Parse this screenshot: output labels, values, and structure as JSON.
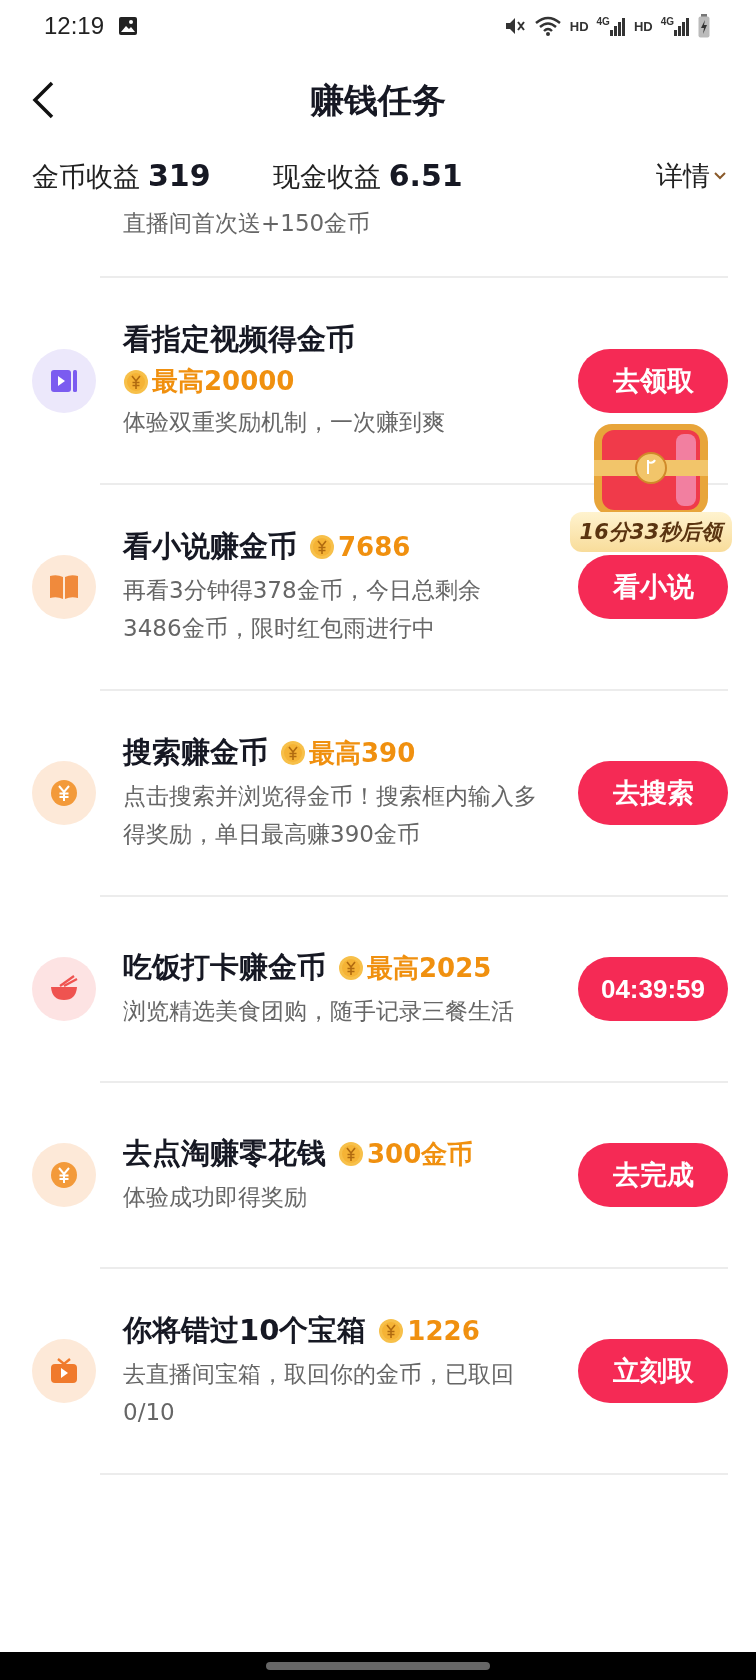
{
  "status_bar": {
    "time": "12:19",
    "indicators": [
      "HD",
      "4G",
      "HD",
      "4G"
    ]
  },
  "header": {
    "title": "赚钱任务"
  },
  "earnings": [
    {
      "label": "金币收益",
      "value": "319"
    },
    {
      "label": "现金收益",
      "value": "6.51"
    }
  ],
  "details_link": "详情",
  "partial_task_description": "直播间首次送+150金币",
  "tasks": [
    {
      "kind": "video",
      "title": "看指定视频得金币",
      "reward_line": "最高20000",
      "description": "体验双重奖励机制，一次赚到爽",
      "button": "去领取"
    },
    {
      "kind": "book",
      "title": "看小说赚金币",
      "reward": "7686",
      "description": "再看3分钟得378金币，今日总剩余3486金币，限时红包雨进行中",
      "button": "看小说"
    },
    {
      "kind": "coin",
      "title": "搜索赚金币",
      "reward": "最高390",
      "description": "点击搜索并浏览得金币！搜索框内输入多得奖励，单日最高赚390金币",
      "button": "去搜索"
    },
    {
      "kind": "bowl",
      "title": "吃饭打卡赚金币",
      "reward": "最高2025",
      "description": "浏览精选美食团购，随手记录三餐生活",
      "countdown": "04:39:59"
    },
    {
      "kind": "coin",
      "title": "去点淘赚零花钱",
      "reward": "300金币",
      "description": "体验成功即得奖励",
      "button": "去完成"
    },
    {
      "kind": "tv",
      "title": "你将错过10个宝箱",
      "reward": "1226",
      "description": "去直播间宝箱，取回你的金币，已取回 0/10",
      "button": "立刻取"
    }
  ],
  "chest": {
    "countdown": "16分33秒后领"
  }
}
